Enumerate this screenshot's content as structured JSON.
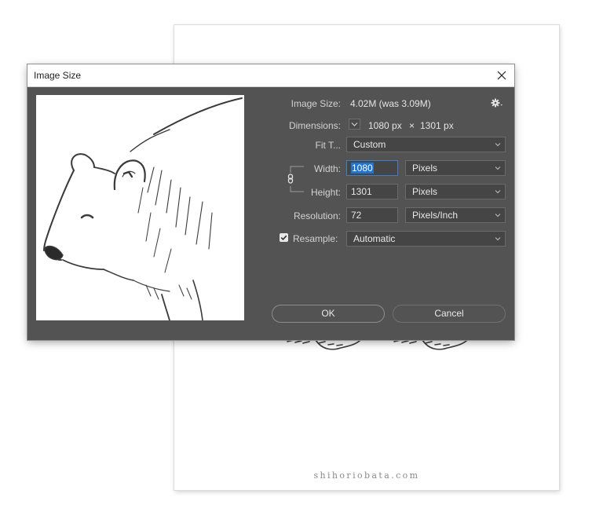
{
  "document": {
    "credit": "shihoriobata.com"
  },
  "dialog": {
    "title": "Image Size",
    "image_size": {
      "label": "Image Size:",
      "value": "4.02M (was 3.09M)"
    },
    "dimensions": {
      "label": "Dimensions:",
      "width": "1080 px",
      "separator": "×",
      "height": "1301 px"
    },
    "fit_to": {
      "label": "Fit T...",
      "value": "Custom"
    },
    "width": {
      "label": "Width:",
      "value": "1080",
      "unit": "Pixels"
    },
    "height": {
      "label": "Height:",
      "value": "1301",
      "unit": "Pixels"
    },
    "resolution": {
      "label": "Resolution:",
      "value": "72",
      "unit": "Pixels/Inch"
    },
    "resample": {
      "label": "Resample:",
      "checked": true,
      "value": "Automatic"
    },
    "buttons": {
      "ok": "OK",
      "cancel": "Cancel"
    }
  },
  "icons": {
    "close": "close-icon",
    "gear": "gear-icon",
    "chevron": "chevron-down-icon",
    "link": "link-icon",
    "check": "checkmark-icon"
  },
  "colors": {
    "dialog_bg": "#535353",
    "field_bg": "#454545",
    "selection": "#1f74d2"
  }
}
